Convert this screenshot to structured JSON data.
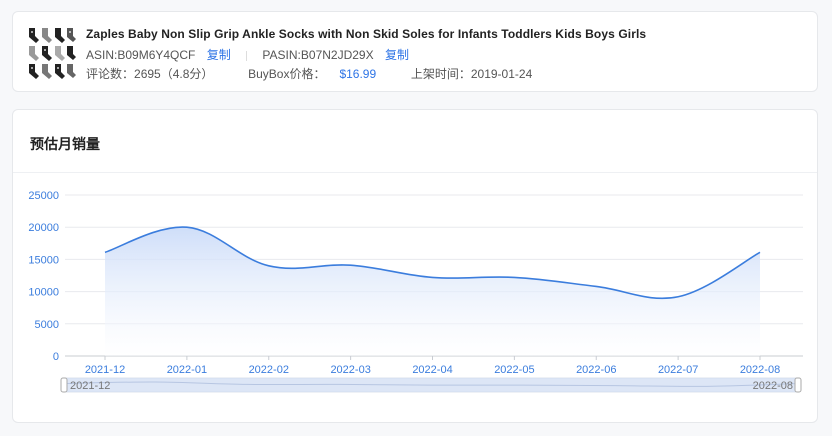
{
  "product": {
    "title": "Zaples Baby Non Slip Grip Ankle Socks with Non Skid Soles for Infants Toddlers Kids Boys Girls",
    "asin_label": "ASIN: ",
    "asin": "B09M6Y4QCF",
    "copy_label_1": "复制",
    "pasin_label": "PASIN: ",
    "pasin": "B07N2JD29X",
    "copy_label_2": "复制",
    "reviews_label": "评论数：",
    "reviews": "2695（4.8分）",
    "buybox_label": "BuyBox价格：",
    "buybox_price": "$16.99",
    "listed_label": "上架时间：",
    "listed_date": "2019-01-24",
    "thumb_icon": "socks-product-thumbnail-icon"
  },
  "chart_section": {
    "title": "预估月销量"
  },
  "chart_data": {
    "type": "area",
    "categories": [
      "2021-12",
      "2022-01",
      "2022-02",
      "2022-03",
      "2022-04",
      "2022-05",
      "2022-06",
      "2022-07",
      "2022-08"
    ],
    "series": [
      {
        "values": [
          16100,
          20000,
          14000,
          14100,
          12200,
          12200,
          10800,
          9200,
          16100
        ]
      }
    ],
    "y_ticks": [
      0,
      5000,
      10000,
      15000,
      20000,
      25000
    ],
    "ylim": [
      0,
      25000
    ],
    "grid": true,
    "colors": {
      "line": "#3b7ddd",
      "fill_top": "#c9daf8",
      "fill_bottom": "#ffffff",
      "tick_text": "#3b7ddd"
    },
    "datazoom": {
      "start_label": "2021-12",
      "end_label": "2022-08"
    }
  }
}
